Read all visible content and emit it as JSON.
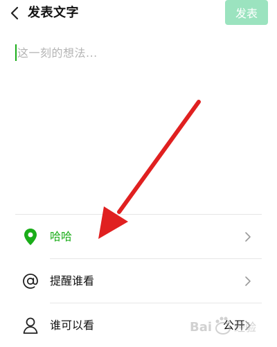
{
  "header": {
    "title": "发表文字",
    "publish_label": "发表"
  },
  "composer": {
    "placeholder": "这一刻的想法..."
  },
  "rows": [
    {
      "label": "哈哈",
      "value": "",
      "icon": "location-pin-icon"
    },
    {
      "label": "提醒谁看",
      "value": "",
      "icon": "at-sign-icon"
    },
    {
      "label": "谁可以看",
      "value": "公开",
      "icon": "person-icon"
    }
  ],
  "colors": {
    "accent": "#1aad19",
    "publish_disabled": "#9be3bf",
    "arrow": "#e02020"
  }
}
